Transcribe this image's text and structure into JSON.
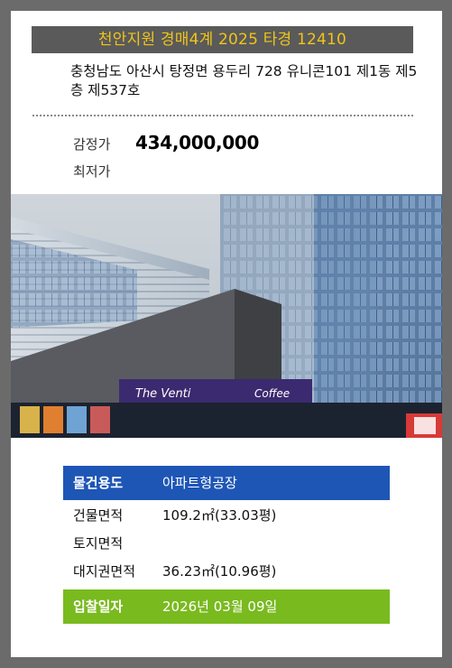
{
  "header": {
    "title": "천안지원 경매4계 2025 타경 12410"
  },
  "property": {
    "address": "충청남도 아산시 탕정면 용두리 728 유니콘101 제1동 제5층 제537호"
  },
  "prices": {
    "appraisal_label": "감정가",
    "appraisal_value": "434,000,000",
    "minimum_label": "최저가",
    "minimum_value": ""
  },
  "photo": {
    "signs": [
      "The Venti",
      "Coffee"
    ]
  },
  "details": {
    "usage_label": "물건용도",
    "usage_value": "아파트형공장",
    "building_area_label": "건물면적",
    "building_area_value": "109.2㎡(33.03평)",
    "land_area_label": "토지면적",
    "land_area_value": "",
    "land_right_area_label": "대지권면적",
    "land_right_area_value": "36.23㎡(10.96평)",
    "bid_date_label": "입찰일자",
    "bid_date_value": "2026년 03월 09일"
  },
  "colors": {
    "title_bg": "#5a5a5a",
    "title_text": "#f0c419",
    "usage_bg": "#1e56b6",
    "date_bg": "#79ba1f"
  }
}
